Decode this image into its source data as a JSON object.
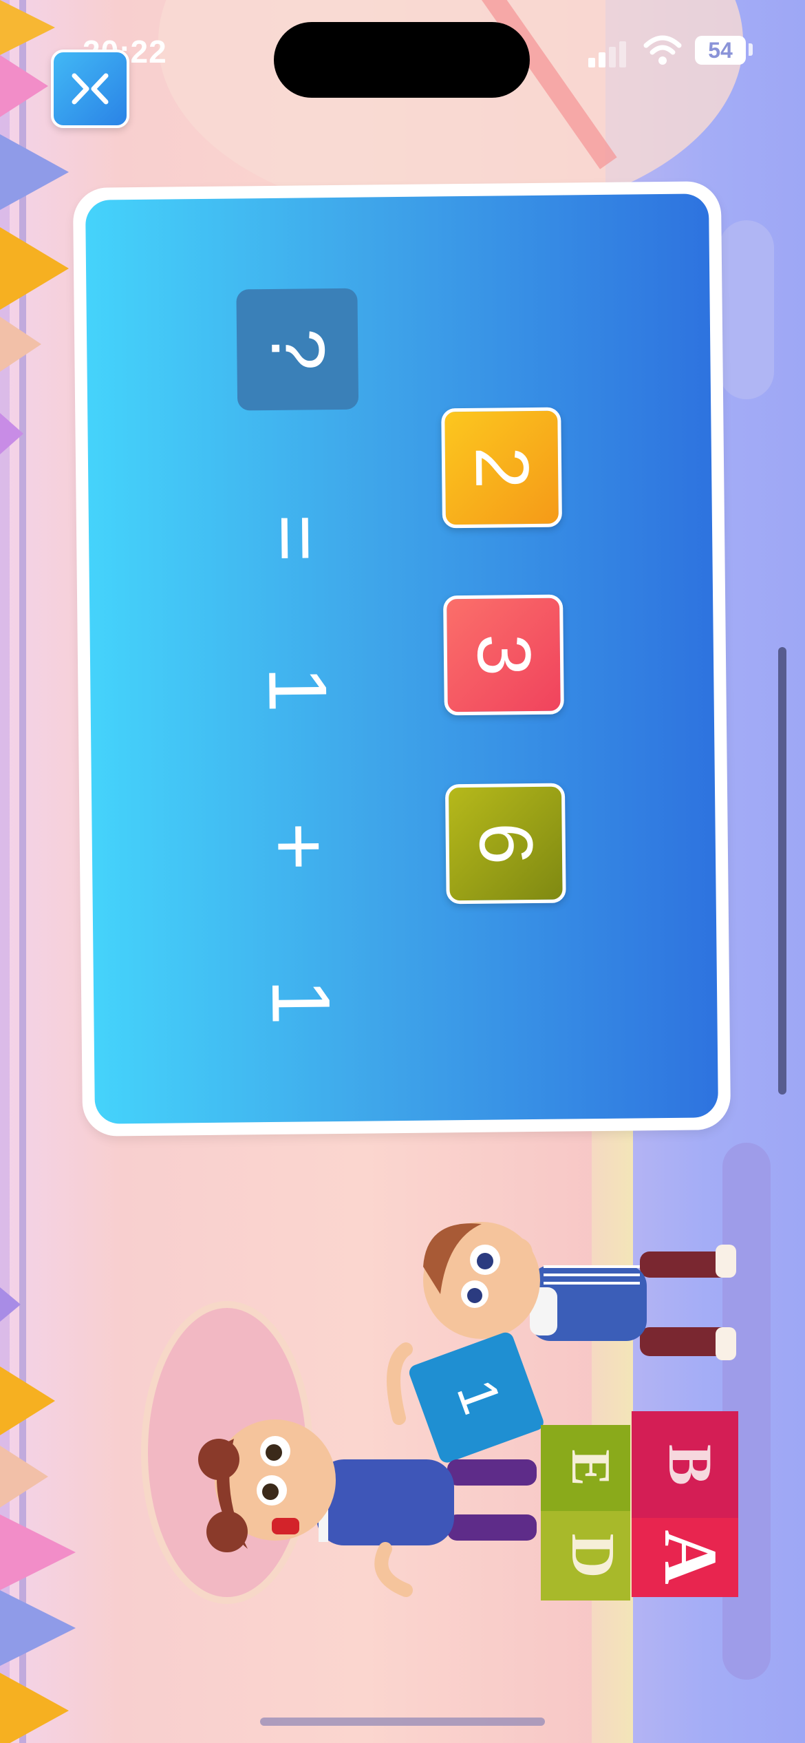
{
  "status_bar": {
    "time": "20:22",
    "battery": "54"
  },
  "colors": {
    "board_start": "#45d3fb",
    "board_end": "#2e73df",
    "question_box": "#3a80b8",
    "option_yellow": "#f6a81d",
    "option_red": "#f25763",
    "option_olive": "#97a014"
  },
  "icons": {
    "exit": "exit-icon",
    "signal": "cellular-signal-icon",
    "wifi": "wifi-icon",
    "battery": "battery-icon"
  },
  "equation": {
    "operand1": "1",
    "operator": "+",
    "operand2": "1",
    "equals": "=",
    "unknown": "?"
  },
  "options": [
    {
      "label": "2"
    },
    {
      "label": "3"
    },
    {
      "label": "6"
    }
  ],
  "illustration": {
    "book_label": "1",
    "blocks": [
      "D",
      "E",
      "A",
      "B"
    ]
  }
}
